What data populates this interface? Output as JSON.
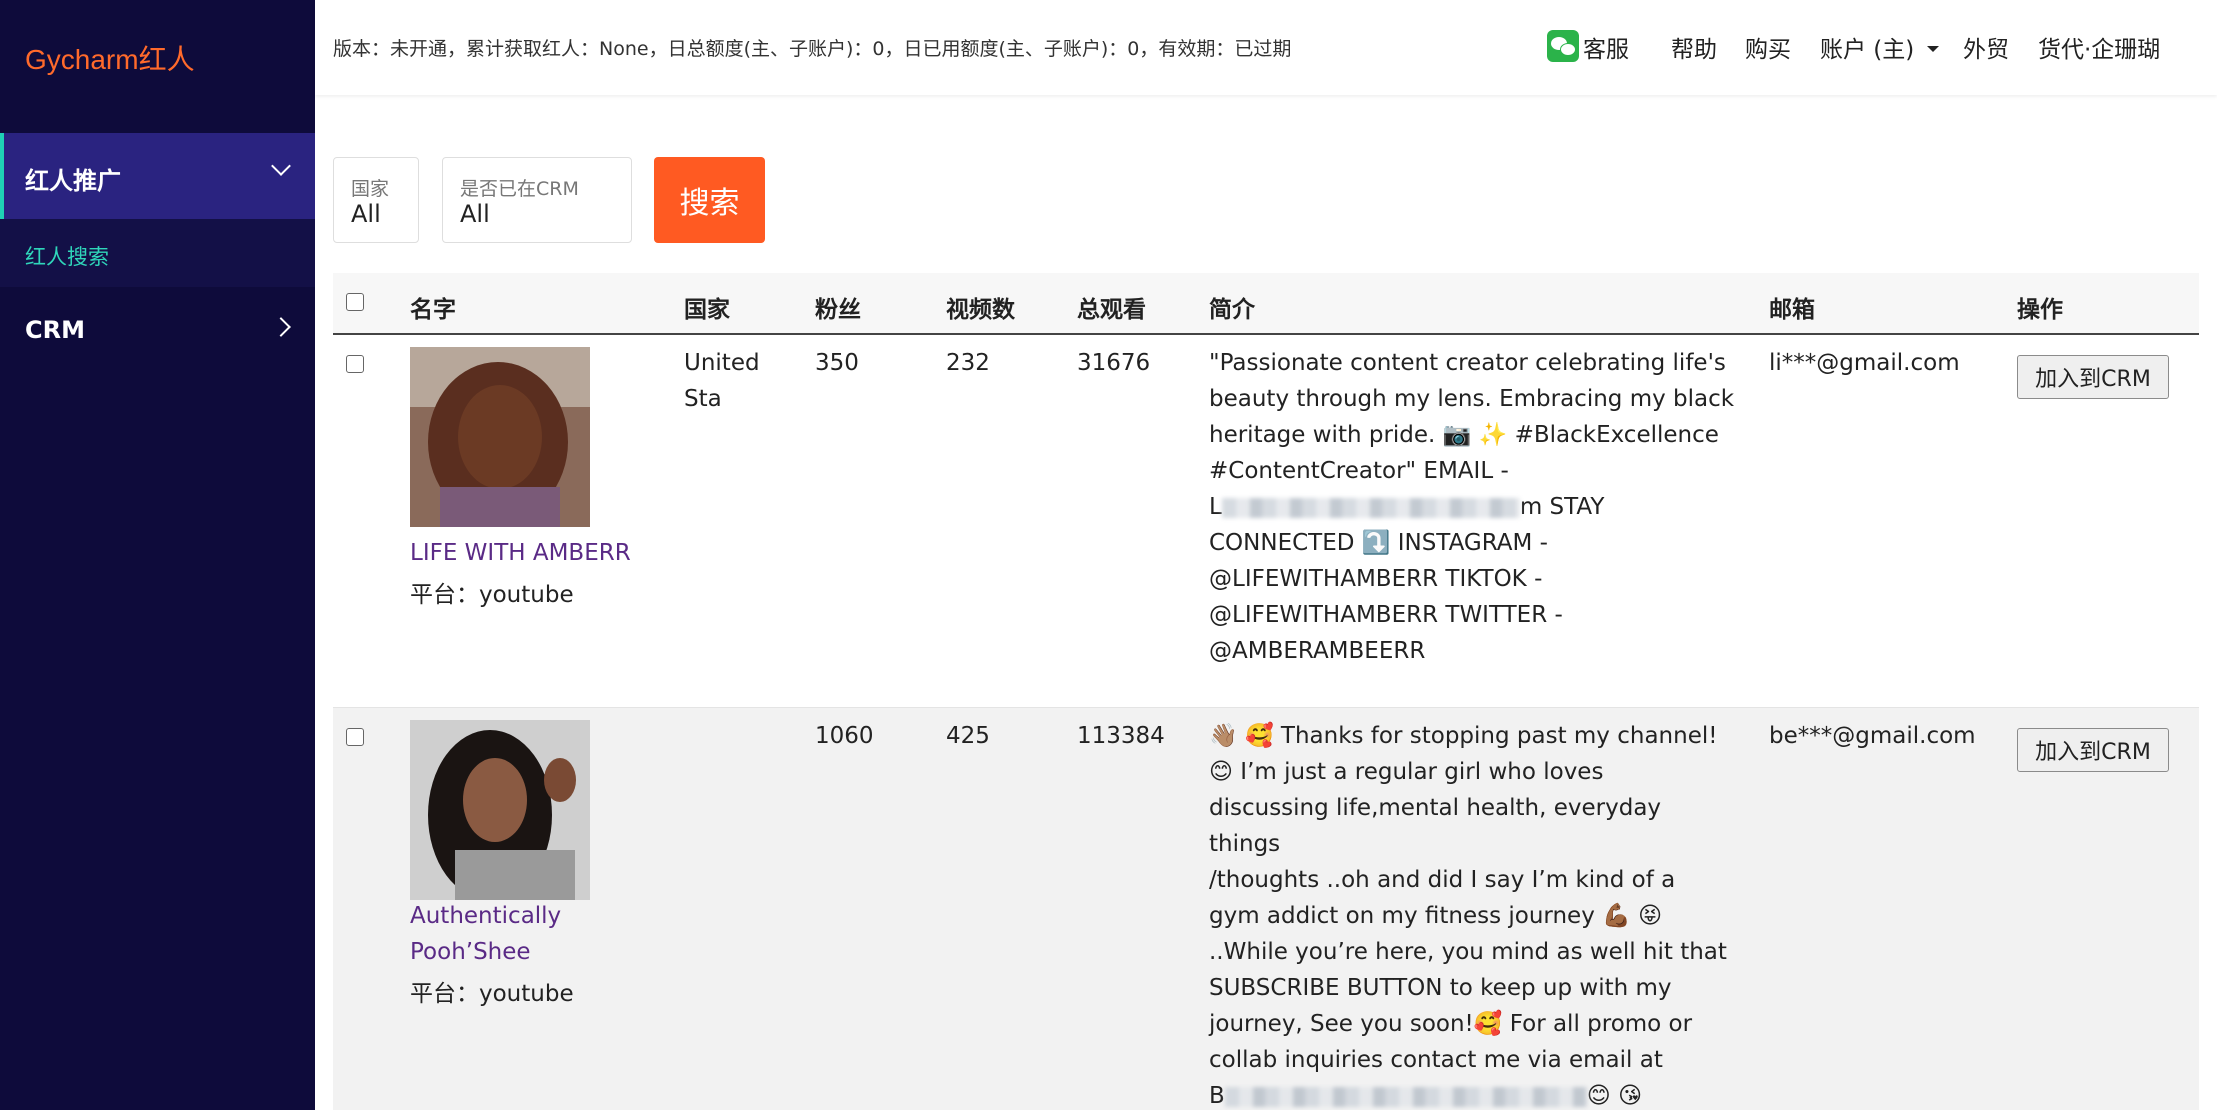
{
  "app": {
    "brand": "Gycharm红人",
    "status": "版本：未开通，累计获取红人：None，日总额度(主、子账户)：0，日已用额度(主、子账户)：0，有效期：已过期"
  },
  "topnav": {
    "service": "客服",
    "help": "帮助",
    "buy": "购买",
    "account": "账户 (主)",
    "trade": "外贸",
    "agency": "货代·企珊瑚"
  },
  "sidebar": {
    "group": "红人推广",
    "sub": "红人搜索",
    "crm": "CRM"
  },
  "filters": {
    "country_label": "国家",
    "country_value": "All",
    "crm_label": "是否已在CRM",
    "crm_value": "All",
    "search_label": "搜索"
  },
  "table": {
    "headers": {
      "name": "名字",
      "country": "国家",
      "fans": "粉丝",
      "videos": "视频数",
      "views": "总观看",
      "bio": "简介",
      "email": "邮箱",
      "action": "操作"
    },
    "action_label": "加入到CRM",
    "rows": [
      {
        "name": "LIFE WITH AMBERR",
        "platform": "平台：youtube",
        "country": "United Sta",
        "fans": "350",
        "videos": "232",
        "views": "31676",
        "email": "li***@gmail.com",
        "bio_a": "\"Passionate content creator celebrating life's\nbeauty through my lens. Embracing my black\nheritage with pride. 📷 ✨ #BlackExcellence\n#ContentCreator\" EMAIL -",
        "bio_b": "L",
        "bio_c": "m STAY",
        "bio_d": "CONNECTED ⤵️ INSTAGRAM -\n@LIFEWITHAMBERR TIKTOK -\n@LIFEWITHAMBERR TWITTER -\n@AMBERAMBEERR"
      },
      {
        "name": "Authentically\nPooh’Shee",
        "platform": "平台：youtube",
        "country": "",
        "fans": "1060",
        "videos": "425",
        "views": "113384",
        "email": "be***@gmail.com",
        "bio_a": "👋🏽 🥰 Thanks for stopping past my channel!\n😊 I’m just a regular girl who loves\ndiscussing life,mental health, everyday things\n/thoughts ..oh and did I say I’m kind of a\ngym addict on my fitness journey 💪🏾 😝\n..While you’re here, you mind as well hit that\nSUBSCRIBE BUTTON to keep up with my\njourney, See you soon!🥰 For all promo or\ncollab inquiries contact me via email at",
        "bio_b": "B",
        "bio_c": "😊 😘"
      }
    ]
  },
  "colors": {
    "sidebar_bg": "#0e0b3b",
    "brand": "#ff6a2b",
    "accent": "#1fd1b5",
    "search_btn": "#ff5a22",
    "link": "#5a2a86"
  }
}
